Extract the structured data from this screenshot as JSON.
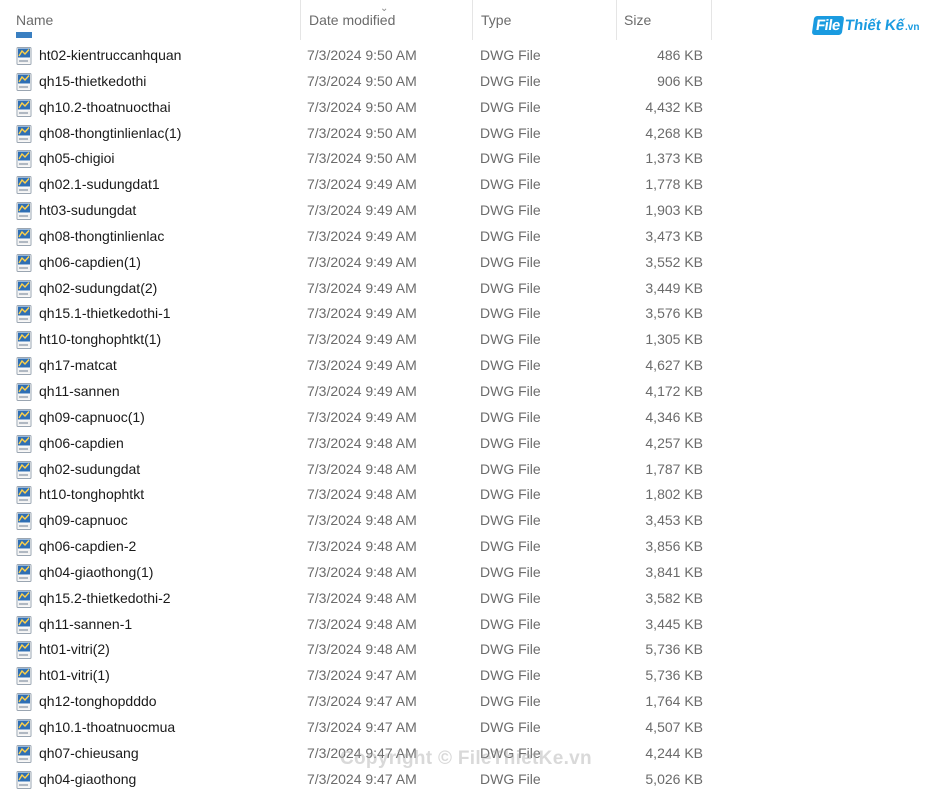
{
  "header": {
    "name": "Name",
    "date": "Date modified",
    "type": "Type",
    "size": "Size"
  },
  "logo": {
    "box": "File",
    "text": "Thiết Kế",
    "domain": ".vn"
  },
  "watermark": "Copyright © FileThietKe.vn",
  "icons": {
    "file": "dwg-file-icon",
    "sort": "chevron-down-icon"
  },
  "colors": {
    "logo": "#1a9be0",
    "text": "#1a1a1a",
    "secondary": "#6b6b6b"
  },
  "files": [
    {
      "name": "ht02-kientruccanhquan",
      "date": "7/3/2024 9:50 AM",
      "type": "DWG File",
      "size": "486 KB"
    },
    {
      "name": "qh15-thietkedothi",
      "date": "7/3/2024 9:50 AM",
      "type": "DWG File",
      "size": "906 KB"
    },
    {
      "name": "qh10.2-thoatnuocthai",
      "date": "7/3/2024 9:50 AM",
      "type": "DWG File",
      "size": "4,432 KB"
    },
    {
      "name": "qh08-thongtinlienlac(1)",
      "date": "7/3/2024 9:50 AM",
      "type": "DWG File",
      "size": "4,268 KB"
    },
    {
      "name": "qh05-chigioi",
      "date": "7/3/2024 9:50 AM",
      "type": "DWG File",
      "size": "1,373 KB"
    },
    {
      "name": "qh02.1-sudungdat1",
      "date": "7/3/2024 9:49 AM",
      "type": "DWG File",
      "size": "1,778 KB"
    },
    {
      "name": "ht03-sudungdat",
      "date": "7/3/2024 9:49 AM",
      "type": "DWG File",
      "size": "1,903 KB"
    },
    {
      "name": "qh08-thongtinlienlac",
      "date": "7/3/2024 9:49 AM",
      "type": "DWG File",
      "size": "3,473 KB"
    },
    {
      "name": "qh06-capdien(1)",
      "date": "7/3/2024 9:49 AM",
      "type": "DWG File",
      "size": "3,552 KB"
    },
    {
      "name": "qh02-sudungdat(2)",
      "date": "7/3/2024 9:49 AM",
      "type": "DWG File",
      "size": "3,449 KB"
    },
    {
      "name": "qh15.1-thietkedothi-1",
      "date": "7/3/2024 9:49 AM",
      "type": "DWG File",
      "size": "3,576 KB"
    },
    {
      "name": "ht10-tonghophtkt(1)",
      "date": "7/3/2024 9:49 AM",
      "type": "DWG File",
      "size": "1,305 KB"
    },
    {
      "name": "qh17-matcat",
      "date": "7/3/2024 9:49 AM",
      "type": "DWG File",
      "size": "4,627 KB"
    },
    {
      "name": "qh11-sannen",
      "date": "7/3/2024 9:49 AM",
      "type": "DWG File",
      "size": "4,172 KB"
    },
    {
      "name": "qh09-capnuoc(1)",
      "date": "7/3/2024 9:49 AM",
      "type": "DWG File",
      "size": "4,346 KB"
    },
    {
      "name": "qh06-capdien",
      "date": "7/3/2024 9:48 AM",
      "type": "DWG File",
      "size": "4,257 KB"
    },
    {
      "name": "qh02-sudungdat",
      "date": "7/3/2024 9:48 AM",
      "type": "DWG File",
      "size": "1,787 KB"
    },
    {
      "name": "ht10-tonghophtkt",
      "date": "7/3/2024 9:48 AM",
      "type": "DWG File",
      "size": "1,802 KB"
    },
    {
      "name": "qh09-capnuoc",
      "date": "7/3/2024 9:48 AM",
      "type": "DWG File",
      "size": "3,453 KB"
    },
    {
      "name": "qh06-capdien-2",
      "date": "7/3/2024 9:48 AM",
      "type": "DWG File",
      "size": "3,856 KB"
    },
    {
      "name": "qh04-giaothong(1)",
      "date": "7/3/2024 9:48 AM",
      "type": "DWG File",
      "size": "3,841 KB"
    },
    {
      "name": "qh15.2-thietkedothi-2",
      "date": "7/3/2024 9:48 AM",
      "type": "DWG File",
      "size": "3,582 KB"
    },
    {
      "name": "qh11-sannen-1",
      "date": "7/3/2024 9:48 AM",
      "type": "DWG File",
      "size": "3,445 KB"
    },
    {
      "name": "ht01-vitri(2)",
      "date": "7/3/2024 9:48 AM",
      "type": "DWG File",
      "size": "5,736 KB"
    },
    {
      "name": "ht01-vitri(1)",
      "date": "7/3/2024 9:47 AM",
      "type": "DWG File",
      "size": "5,736 KB"
    },
    {
      "name": "qh12-tonghopdddo",
      "date": "7/3/2024 9:47 AM",
      "type": "DWG File",
      "size": "1,764 KB"
    },
    {
      "name": "qh10.1-thoatnuocmua",
      "date": "7/3/2024 9:47 AM",
      "type": "DWG File",
      "size": "4,507 KB"
    },
    {
      "name": "qh07-chieusang",
      "date": "7/3/2024 9:47 AM",
      "type": "DWG File",
      "size": "4,244 KB"
    },
    {
      "name": "qh04-giaothong",
      "date": "7/3/2024 9:47 AM",
      "type": "DWG File",
      "size": "5,026 KB"
    }
  ]
}
